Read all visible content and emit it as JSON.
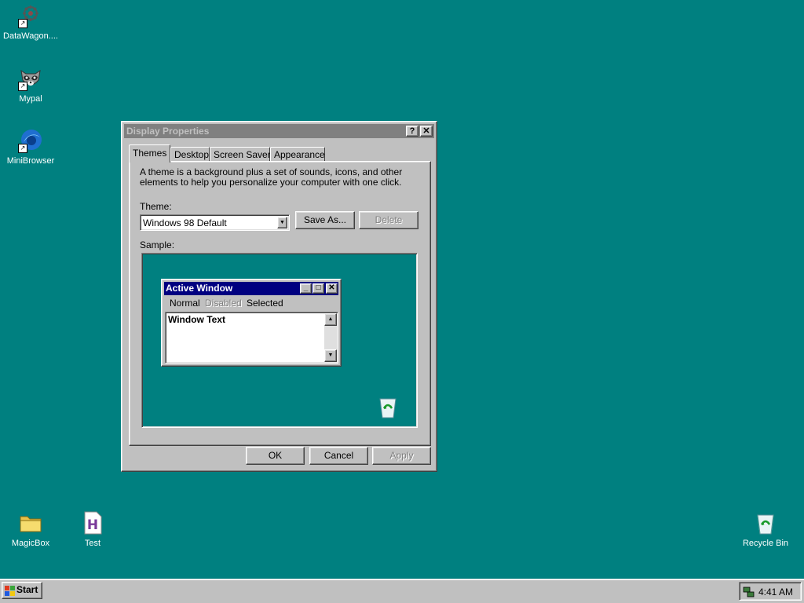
{
  "desktop": {
    "icons": [
      {
        "label": "DataWagon...."
      },
      {
        "label": "Mypal"
      },
      {
        "label": "MiniBrowser"
      },
      {
        "label": "MagicBox"
      },
      {
        "label": "Test"
      },
      {
        "label": "Recycle Bin"
      }
    ],
    "background_color": "#008080"
  },
  "dialog": {
    "title": "Display Properties",
    "help_button": "?",
    "close_button": "✕",
    "tabs": [
      "Themes",
      "Desktop",
      "Screen Saver",
      "Appearance"
    ],
    "active_tab": "Themes",
    "description": "A theme is a background plus a set of sounds, icons, and other elements to help you personalize your computer with one click.",
    "theme_label": "Theme:",
    "theme_value": "Windows 98 Default",
    "save_as": "Save As...",
    "delete": "Delete",
    "sample_label": "Sample:",
    "ok": "OK",
    "cancel": "Cancel",
    "apply": "Apply"
  },
  "sample": {
    "window_title": "Active Window",
    "menu_normal": "Normal",
    "menu_disabled": "Disabled",
    "menu_selected": "Selected",
    "window_text": "Window Text"
  },
  "taskbar": {
    "start_label": "Start",
    "clock": "4:41 AM"
  },
  "colors": {
    "desktop": "#008080",
    "active_title": "#000080",
    "inactive_title": "#808080",
    "face": "#c0c0c0"
  }
}
